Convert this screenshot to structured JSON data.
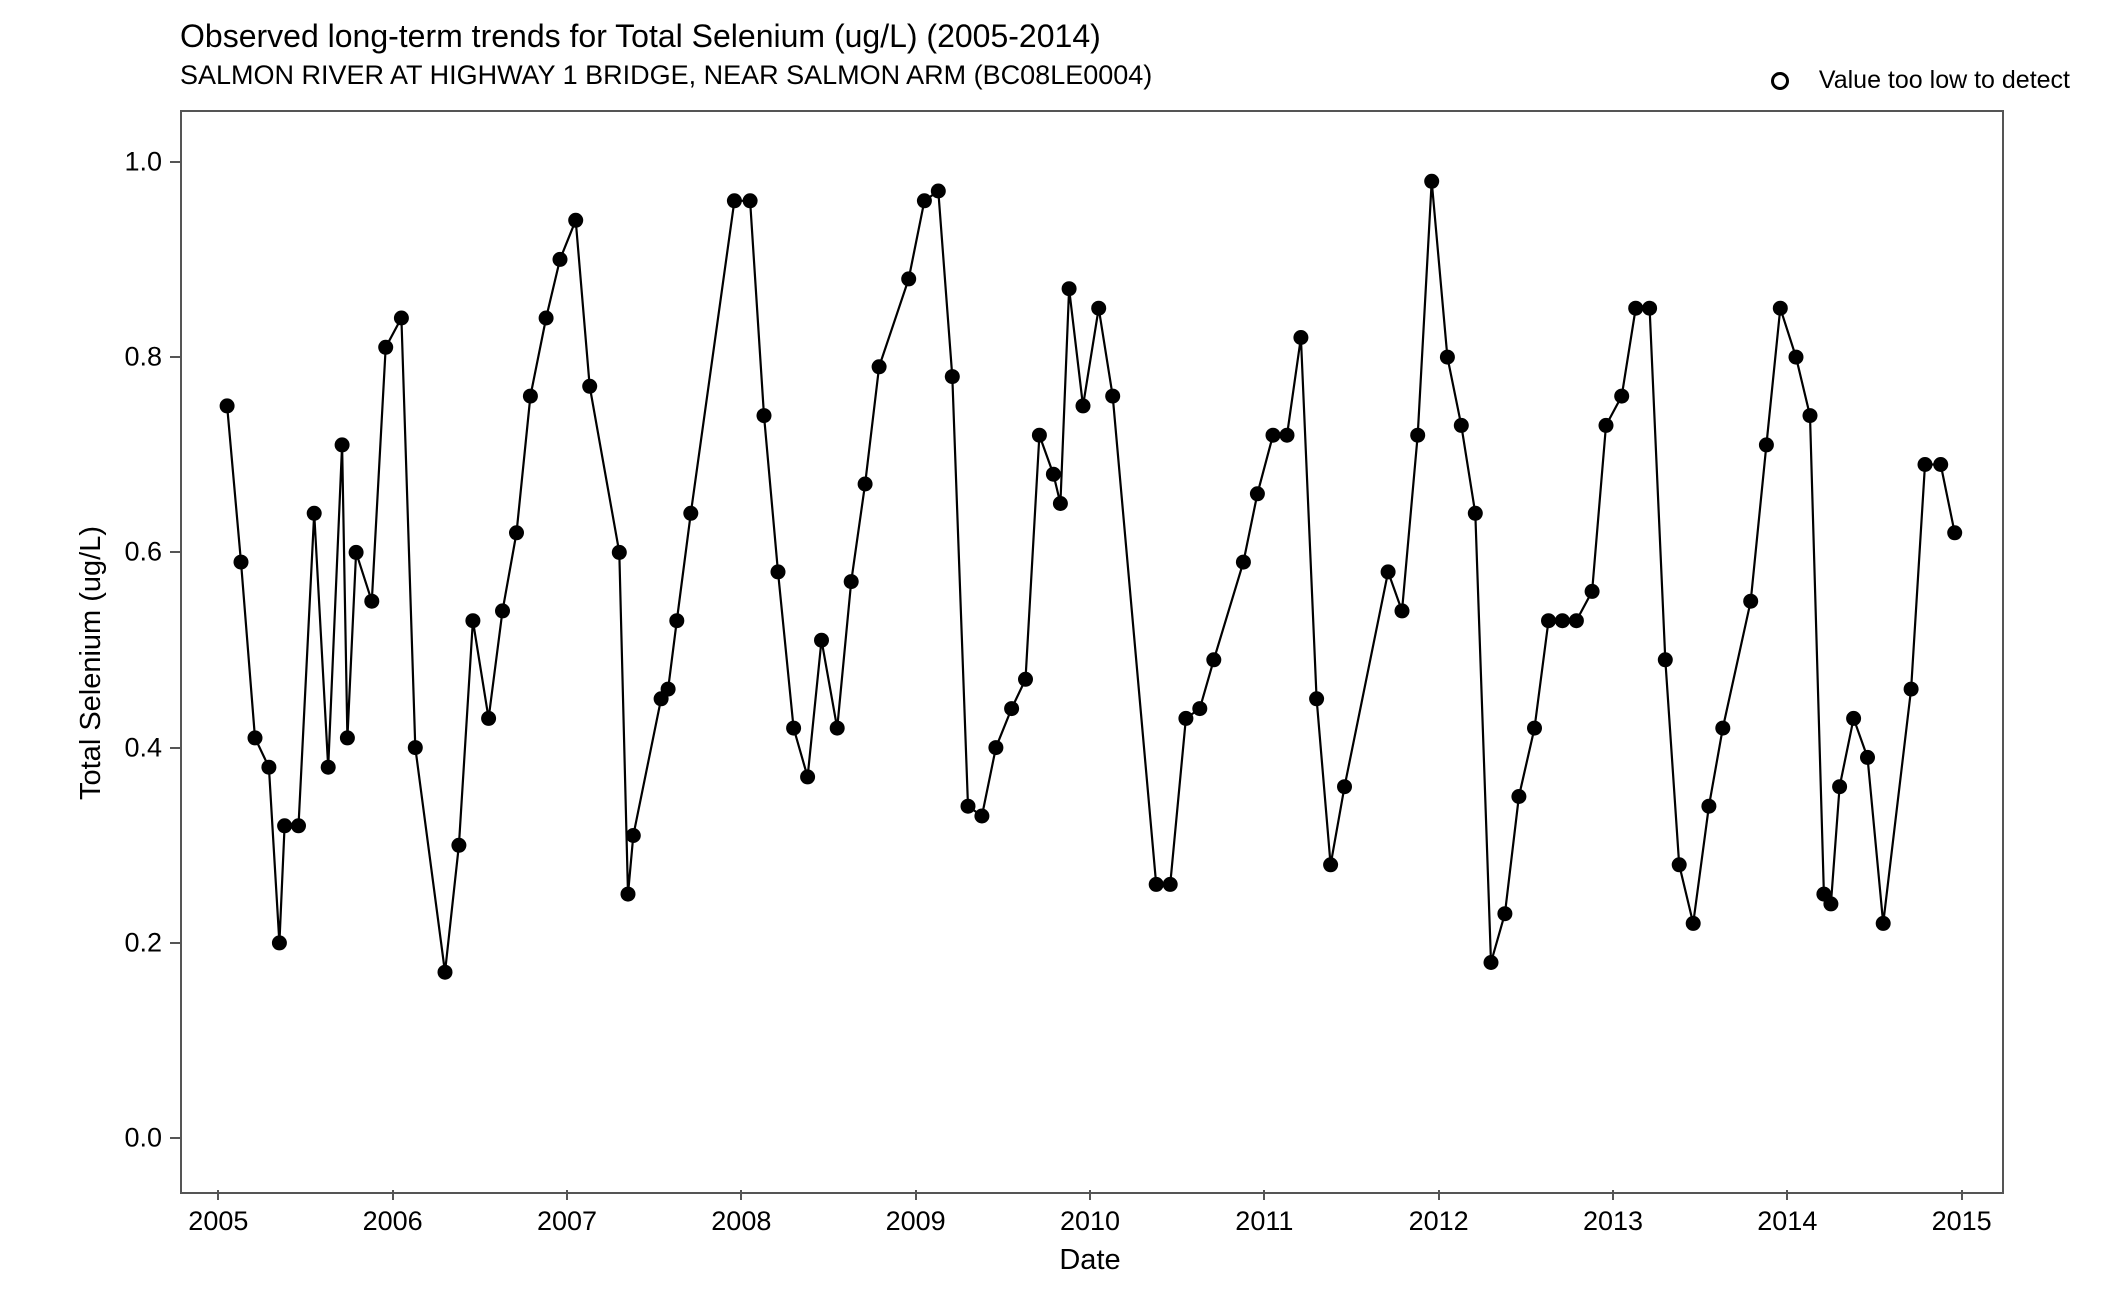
{
  "chart_data": {
    "type": "line",
    "title": "Observed long-term trends for Total Selenium (ug/L) (2005-2014)",
    "subtitle": "SALMON RIVER AT HIGHWAY 1 BRIDGE, NEAR SALMON ARM (BC08LE0004)",
    "xlabel": "Date",
    "ylabel": "Total Selenium (ug/L)",
    "ylim": [
      0.0,
      1.0
    ],
    "x_ticks": [
      2005,
      2006,
      2007,
      2008,
      2009,
      2010,
      2011,
      2012,
      2013,
      2014,
      2015
    ],
    "y_ticks": [
      0.0,
      0.2,
      0.4,
      0.6,
      0.8,
      1.0
    ],
    "legend": [
      {
        "label": "Value too low to detect",
        "marker": "open-circle"
      }
    ],
    "series": [
      {
        "name": "Total Selenium",
        "marker": "filled-circle",
        "data": [
          {
            "x": 2005.05,
            "y": 0.75
          },
          {
            "x": 2005.13,
            "y": 0.59
          },
          {
            "x": 2005.21,
            "y": 0.41
          },
          {
            "x": 2005.29,
            "y": 0.38
          },
          {
            "x": 2005.35,
            "y": 0.2
          },
          {
            "x": 2005.38,
            "y": 0.32
          },
          {
            "x": 2005.46,
            "y": 0.32
          },
          {
            "x": 2005.55,
            "y": 0.64
          },
          {
            "x": 2005.63,
            "y": 0.38
          },
          {
            "x": 2005.71,
            "y": 0.71
          },
          {
            "x": 2005.74,
            "y": 0.41
          },
          {
            "x": 2005.79,
            "y": 0.6
          },
          {
            "x": 2005.88,
            "y": 0.55
          },
          {
            "x": 2005.96,
            "y": 0.81
          },
          {
            "x": 2006.05,
            "y": 0.84
          },
          {
            "x": 2006.13,
            "y": 0.4
          },
          {
            "x": 2006.3,
            "y": 0.17
          },
          {
            "x": 2006.38,
            "y": 0.3
          },
          {
            "x": 2006.46,
            "y": 0.53
          },
          {
            "x": 2006.55,
            "y": 0.43
          },
          {
            "x": 2006.63,
            "y": 0.54
          },
          {
            "x": 2006.71,
            "y": 0.62
          },
          {
            "x": 2006.79,
            "y": 0.76
          },
          {
            "x": 2006.88,
            "y": 0.84
          },
          {
            "x": 2006.96,
            "y": 0.9
          },
          {
            "x": 2007.05,
            "y": 0.94
          },
          {
            "x": 2007.13,
            "y": 0.77
          },
          {
            "x": 2007.3,
            "y": 0.6
          },
          {
            "x": 2007.35,
            "y": 0.25
          },
          {
            "x": 2007.38,
            "y": 0.31
          },
          {
            "x": 2007.54,
            "y": 0.45
          },
          {
            "x": 2007.58,
            "y": 0.46
          },
          {
            "x": 2007.63,
            "y": 0.53
          },
          {
            "x": 2007.71,
            "y": 0.64
          },
          {
            "x": 2007.96,
            "y": 0.96
          },
          {
            "x": 2008.05,
            "y": 0.96
          },
          {
            "x": 2008.13,
            "y": 0.74
          },
          {
            "x": 2008.21,
            "y": 0.58
          },
          {
            "x": 2008.3,
            "y": 0.42
          },
          {
            "x": 2008.38,
            "y": 0.37
          },
          {
            "x": 2008.46,
            "y": 0.51
          },
          {
            "x": 2008.55,
            "y": 0.42
          },
          {
            "x": 2008.63,
            "y": 0.57
          },
          {
            "x": 2008.71,
            "y": 0.67
          },
          {
            "x": 2008.79,
            "y": 0.79
          },
          {
            "x": 2008.96,
            "y": 0.88
          },
          {
            "x": 2009.05,
            "y": 0.96
          },
          {
            "x": 2009.13,
            "y": 0.97
          },
          {
            "x": 2009.21,
            "y": 0.78
          },
          {
            "x": 2009.3,
            "y": 0.34
          },
          {
            "x": 2009.38,
            "y": 0.33
          },
          {
            "x": 2009.46,
            "y": 0.4
          },
          {
            "x": 2009.55,
            "y": 0.44
          },
          {
            "x": 2009.63,
            "y": 0.47
          },
          {
            "x": 2009.71,
            "y": 0.72
          },
          {
            "x": 2009.79,
            "y": 0.68
          },
          {
            "x": 2009.83,
            "y": 0.65
          },
          {
            "x": 2009.88,
            "y": 0.87
          },
          {
            "x": 2009.96,
            "y": 0.75
          },
          {
            "x": 2010.05,
            "y": 0.85
          },
          {
            "x": 2010.13,
            "y": 0.76
          },
          {
            "x": 2010.38,
            "y": 0.26
          },
          {
            "x": 2010.46,
            "y": 0.26
          },
          {
            "x": 2010.55,
            "y": 0.43
          },
          {
            "x": 2010.63,
            "y": 0.44
          },
          {
            "x": 2010.71,
            "y": 0.49
          },
          {
            "x": 2010.88,
            "y": 0.59
          },
          {
            "x": 2010.96,
            "y": 0.66
          },
          {
            "x": 2011.05,
            "y": 0.72
          },
          {
            "x": 2011.13,
            "y": 0.72
          },
          {
            "x": 2011.21,
            "y": 0.82
          },
          {
            "x": 2011.3,
            "y": 0.45
          },
          {
            "x": 2011.38,
            "y": 0.28
          },
          {
            "x": 2011.46,
            "y": 0.36
          },
          {
            "x": 2011.71,
            "y": 0.58
          },
          {
            "x": 2011.79,
            "y": 0.54
          },
          {
            "x": 2011.88,
            "y": 0.72
          },
          {
            "x": 2011.96,
            "y": 0.98
          },
          {
            "x": 2012.05,
            "y": 0.8
          },
          {
            "x": 2012.13,
            "y": 0.73
          },
          {
            "x": 2012.21,
            "y": 0.64
          },
          {
            "x": 2012.3,
            "y": 0.18
          },
          {
            "x": 2012.38,
            "y": 0.23
          },
          {
            "x": 2012.46,
            "y": 0.35
          },
          {
            "x": 2012.55,
            "y": 0.42
          },
          {
            "x": 2012.63,
            "y": 0.53
          },
          {
            "x": 2012.71,
            "y": 0.53
          },
          {
            "x": 2012.79,
            "y": 0.53
          },
          {
            "x": 2012.88,
            "y": 0.56
          },
          {
            "x": 2012.96,
            "y": 0.73
          },
          {
            "x": 2013.05,
            "y": 0.76
          },
          {
            "x": 2013.13,
            "y": 0.85
          },
          {
            "x": 2013.21,
            "y": 0.85
          },
          {
            "x": 2013.3,
            "y": 0.49
          },
          {
            "x": 2013.38,
            "y": 0.28
          },
          {
            "x": 2013.46,
            "y": 0.22
          },
          {
            "x": 2013.55,
            "y": 0.34
          },
          {
            "x": 2013.63,
            "y": 0.42
          },
          {
            "x": 2013.79,
            "y": 0.55
          },
          {
            "x": 2013.88,
            "y": 0.71
          },
          {
            "x": 2013.96,
            "y": 0.85
          },
          {
            "x": 2014.05,
            "y": 0.8
          },
          {
            "x": 2014.13,
            "y": 0.74
          },
          {
            "x": 2014.21,
            "y": 0.25
          },
          {
            "x": 2014.25,
            "y": 0.24
          },
          {
            "x": 2014.3,
            "y": 0.36
          },
          {
            "x": 2014.38,
            "y": 0.43
          },
          {
            "x": 2014.46,
            "y": 0.39
          },
          {
            "x": 2014.55,
            "y": 0.22
          },
          {
            "x": 2014.71,
            "y": 0.46
          },
          {
            "x": 2014.79,
            "y": 0.69
          },
          {
            "x": 2014.88,
            "y": 0.69
          },
          {
            "x": 2014.96,
            "y": 0.62
          }
        ]
      }
    ]
  }
}
